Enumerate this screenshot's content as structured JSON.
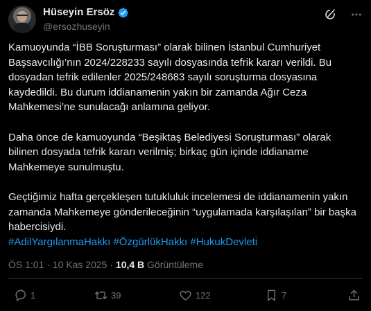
{
  "author": {
    "display_name": "Hüseyin Ersöz",
    "handle": "@ersozhuseyin",
    "verified": true
  },
  "header_icons": [
    "grok-icon",
    "more-icon"
  ],
  "post": {
    "paragraphs": [
      "Kamuoyunda “İBB Soruşturması” olarak bilinen İstanbul Cumhuriyet Başsavcılığı’nın 2024/228233 sayılı dosyasında tefrik kararı verildi. Bu dosyadan tefrik edilenler 2025/248683 sayılı soruşturma dosyasına kaydedildi. Bu durum iddianamenin yakın bir zamanda Ağır Ceza Mahkemesi’ne sunulacağı anlamına geliyor.",
      "Daha önce de kamuoyunda “Beşiktaş Belediyesi Soruşturması” olarak bilinen dosyada tefrik kararı verilmiş; birkaç gün içinde iddianame Mahkemeye sunulmuştu.",
      "Geçtiğimiz hafta gerçekleşen tutukluluk incelemesi de iddianamenin yakın zamanda Mahkemeye gönderileceğinin “uygulamada karşılaşılan” bir başka habercisiydi."
    ],
    "hashtags": [
      "#AdilYargılanmaHakkı",
      "#ÖzgürlükHakkı",
      "#HukukDevleti"
    ]
  },
  "meta": {
    "time": "ÖS 1:01",
    "separator": "·",
    "date": "10 Kas 2025",
    "views_count": "10,4 B",
    "views_label": "Görüntüleme"
  },
  "actions": {
    "replies": "1",
    "reposts": "39",
    "likes": "122",
    "bookmarks": "7"
  },
  "colors": {
    "background": "#000000",
    "text": "#e7e9ea",
    "secondary": "#71767b",
    "accent": "#1d9bf0"
  }
}
